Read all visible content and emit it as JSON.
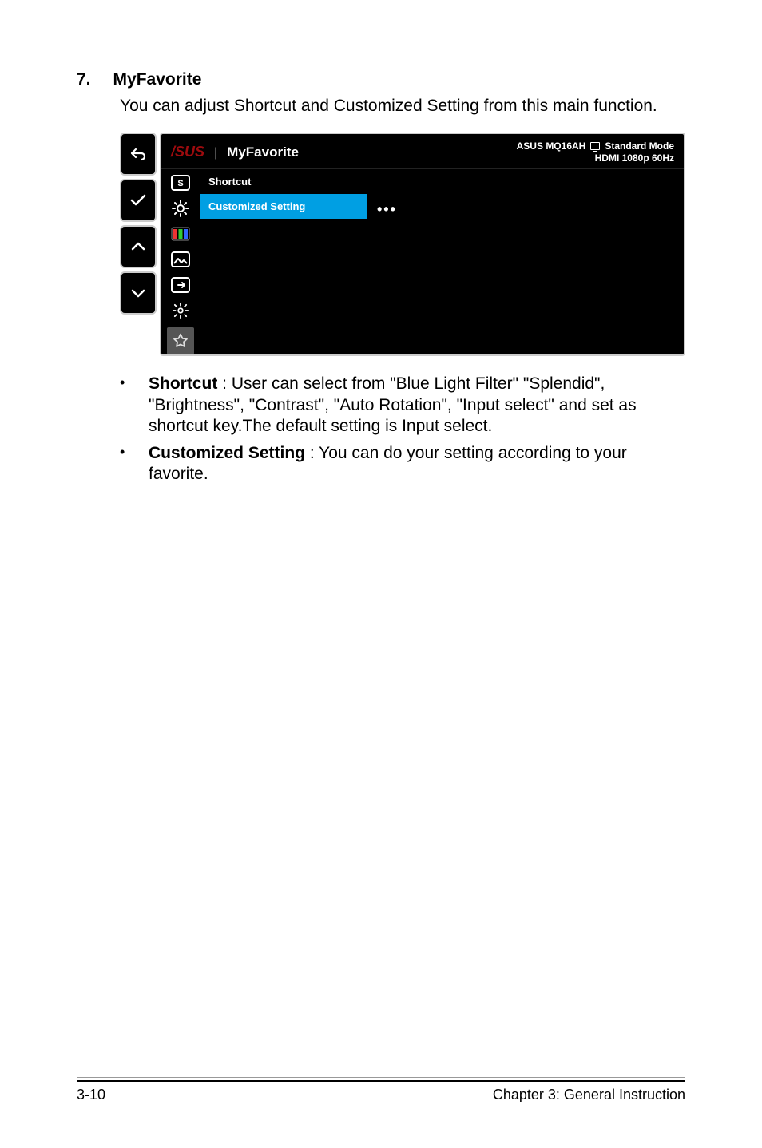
{
  "section_number": "7.",
  "section_title": "MyFavorite",
  "section_description": "You can adjust Shortcut and Customized Setting from this main function.",
  "osd": {
    "header": {
      "brand": "/SUS",
      "title": "MyFavorite",
      "model": "ASUS MQ16AH",
      "mode": "Standard Mode",
      "signal": "HDMI  1080p 60Hz"
    },
    "menu_items": {
      "0": "Shortcut",
      "1": "Customized Setting"
    },
    "submenu_indicator": "•••"
  },
  "bullets": {
    "0": {
      "lead": "Shortcut",
      "rest": " : User can select from \"Blue Light Filter\" \"Splendid\", \"Brightness\", \"Contrast\", \"Auto Rotation\", \"Input select\" and set as shortcut key.The default setting is Input select."
    },
    "1": {
      "lead": "Customized Setting",
      "rest": " : You can do your setting according to your favorite."
    }
  },
  "footer": {
    "left": "3-10",
    "right": "Chapter 3: General Instruction"
  }
}
